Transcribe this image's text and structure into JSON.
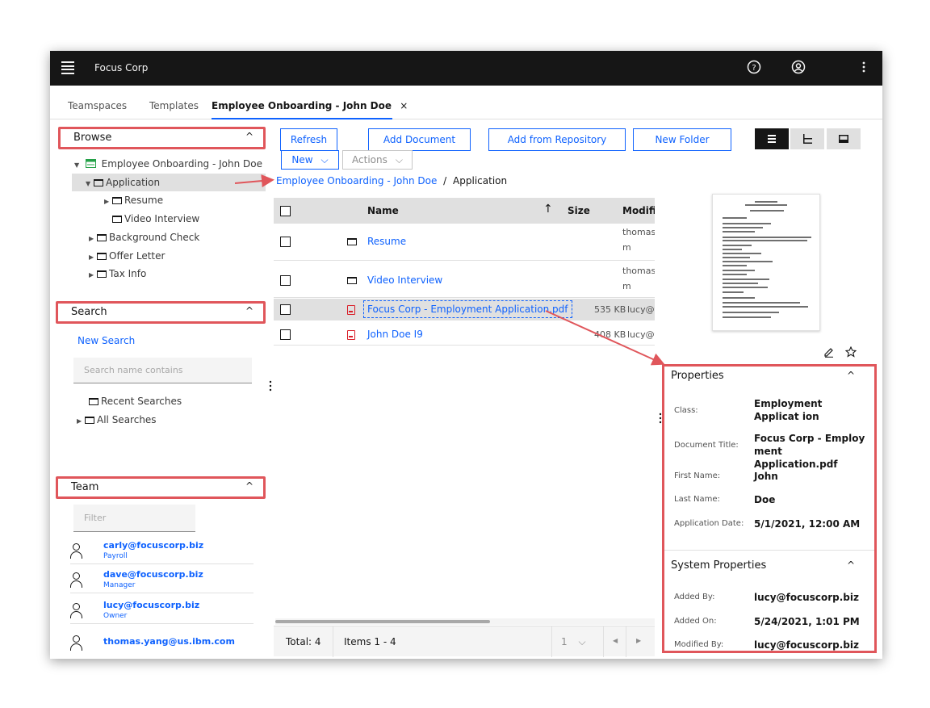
{
  "app": {
    "brand": "Focus Corp"
  },
  "topbar": {
    "help_icon": "?",
    "user_icon": "☺",
    "more_icon": "⋮"
  },
  "tabs": [
    {
      "label": "Teamspaces"
    },
    {
      "label": "Templates"
    },
    {
      "label": "Employee Onboarding - John Doe",
      "close": "×"
    }
  ],
  "browse": {
    "title": "Browse",
    "root": "Employee Onboarding - John Doe",
    "items": [
      {
        "label": "Application"
      },
      {
        "label": "Resume"
      },
      {
        "label": "Video Interview"
      },
      {
        "label": "Background Check"
      },
      {
        "label": "Offer Letter"
      },
      {
        "label": "Tax Info"
      }
    ]
  },
  "search": {
    "title": "Search",
    "new_search": "New Search",
    "placeholder": "Search name contains",
    "recent": "Recent Searches",
    "all": "All Searches"
  },
  "team": {
    "title": "Team",
    "filter_placeholder": "Filter",
    "members": [
      {
        "email": "carly@focuscorp.biz",
        "role": "Payroll"
      },
      {
        "email": "dave@focuscorp.biz",
        "role": "Manager"
      },
      {
        "email": "lucy@focuscorp.biz",
        "role": "Owner"
      },
      {
        "email": "thomas.yang@us.ibm.com",
        "role": ""
      }
    ]
  },
  "toolbar": {
    "refresh": "Refresh",
    "add_document": "Add Document",
    "add_from_repository": "Add from Repository",
    "new_folder": "New Folder",
    "new": "New",
    "actions": "Actions"
  },
  "breadcrumb": {
    "root": "Employee Onboarding - John Doe",
    "sep": "/",
    "current": "Application"
  },
  "table": {
    "headers": {
      "name": "Name",
      "size": "Size",
      "modified": "Modifie"
    },
    "sort_icon": "↑",
    "rows": [
      {
        "name": "Resume",
        "size": "",
        "modified": "thomas",
        "modified2": "m",
        "type": "folder"
      },
      {
        "name": "Video Interview",
        "size": "",
        "modified": "thomas",
        "modified2": "m",
        "type": "folder"
      },
      {
        "name": "Focus Corp - Employment Application.pdf",
        "size": "535 KB",
        "modified": "lucy@fc",
        "modified2": "",
        "type": "pdf"
      },
      {
        "name": "John Doe I9",
        "size": "408 KB",
        "modified": "lucy@fc",
        "modified2": "",
        "type": "pdf"
      }
    ],
    "footer": {
      "total": "Total: 4",
      "items": "Items 1 - 4",
      "page": "1"
    }
  },
  "properties": {
    "title": "Properties",
    "fields": [
      {
        "label": "Class:",
        "value": "Employment Applicat ion"
      },
      {
        "label": "Document Title:",
        "value": "Focus Corp - Employ ment Application.pdf"
      },
      {
        "label": "First Name:",
        "value": "John"
      },
      {
        "label": "Last Name:",
        "value": "Doe"
      },
      {
        "label": "Application Date:",
        "value": "5/1/2021, 12:00 AM"
      }
    ],
    "system_title": "System Properties",
    "system_fields": [
      {
        "label": "Added By:",
        "value": "lucy@focuscorp.biz"
      },
      {
        "label": "Added On:",
        "value": "5/24/2021, 1:01 PM"
      },
      {
        "label": "Modified By:",
        "value": "lucy@focuscorp.biz"
      }
    ]
  },
  "colors": {
    "accent": "#0f62fe",
    "highlight": "#e0565b",
    "topbar": "#161616"
  }
}
